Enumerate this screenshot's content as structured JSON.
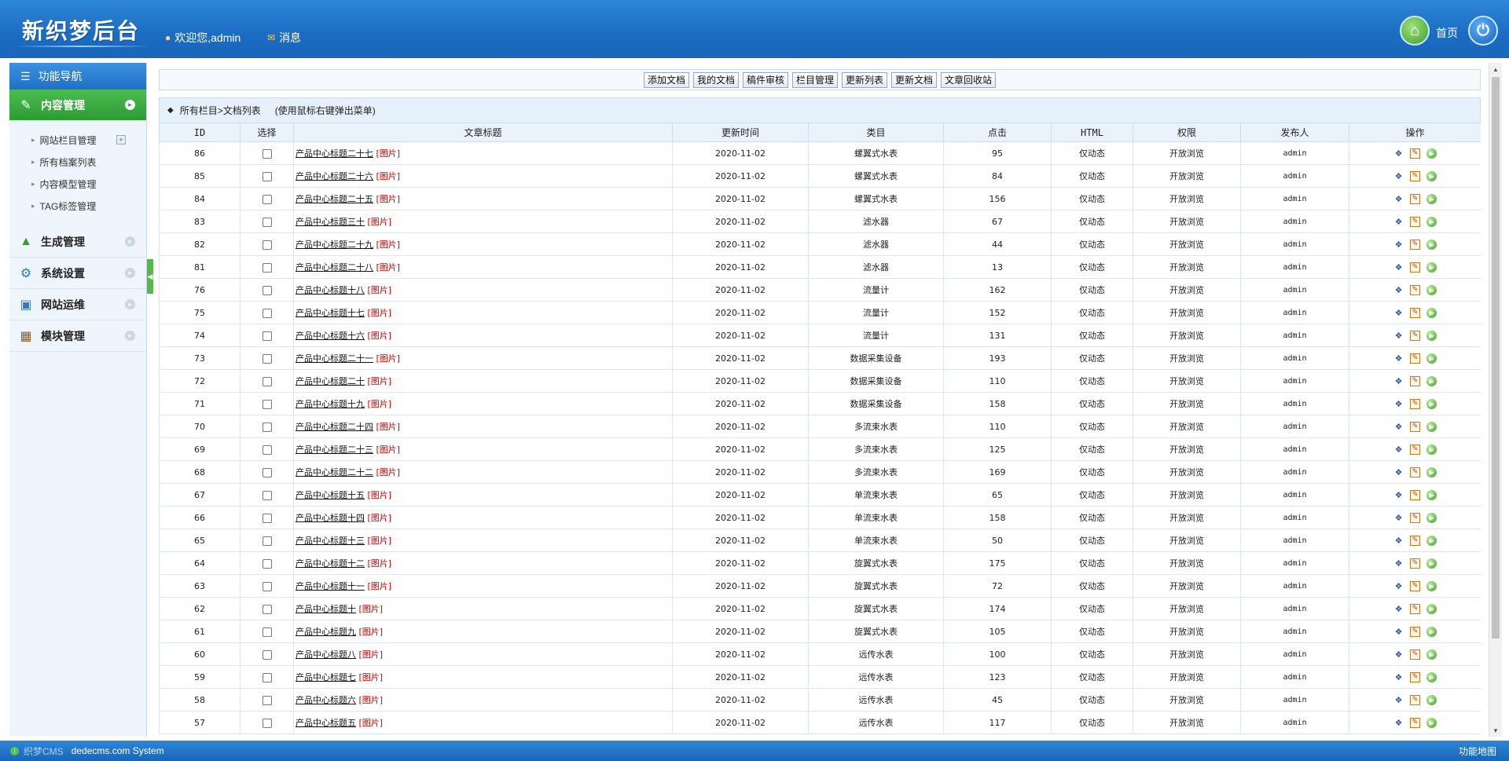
{
  "header": {
    "logo": "新织梦后台",
    "welcome": "欢迎您,admin",
    "messages": "消息",
    "home": "首页"
  },
  "sidebar": {
    "title": "功能导航",
    "sections": [
      {
        "label": "内容管理",
        "active": true
      },
      {
        "label": "生成管理"
      },
      {
        "label": "系统设置"
      },
      {
        "label": "网站运维"
      },
      {
        "label": "模块管理"
      }
    ],
    "content_items": [
      "网站栏目管理",
      "所有档案列表",
      "内容模型管理",
      "TAG标签管理"
    ]
  },
  "toolbar": {
    "buttons": [
      "添加文档",
      "我的文档",
      "稿件审核",
      "栏目管理",
      "更新列表",
      "更新文档",
      "文章回收站"
    ]
  },
  "list": {
    "heading": "所有栏目>文档列表",
    "hint": "(使用鼠标右键弹出菜单)",
    "columns": [
      "ID",
      "选择",
      "文章标题",
      "更新时间",
      "类目",
      "点击",
      "HTML",
      "权限",
      "发布人",
      "操作"
    ],
    "pic_tag": "[图片]",
    "rows": [
      {
        "id": "86",
        "title": "产品中心标题二十七",
        "date": "2020-11-02",
        "category": "螺翼式水表",
        "clicks": "95",
        "html": "仅动态",
        "perm": "开放浏览",
        "author": "admin"
      },
      {
        "id": "85",
        "title": "产品中心标题二十六",
        "date": "2020-11-02",
        "category": "螺翼式水表",
        "clicks": "84",
        "html": "仅动态",
        "perm": "开放浏览",
        "author": "admin"
      },
      {
        "id": "84",
        "title": "产品中心标题二十五",
        "date": "2020-11-02",
        "category": "螺翼式水表",
        "clicks": "156",
        "html": "仅动态",
        "perm": "开放浏览",
        "author": "admin"
      },
      {
        "id": "83",
        "title": "产品中心标题三十",
        "date": "2020-11-02",
        "category": "滤水器",
        "clicks": "67",
        "html": "仅动态",
        "perm": "开放浏览",
        "author": "admin"
      },
      {
        "id": "82",
        "title": "产品中心标题二十九",
        "date": "2020-11-02",
        "category": "滤水器",
        "clicks": "44",
        "html": "仅动态",
        "perm": "开放浏览",
        "author": "admin"
      },
      {
        "id": "81",
        "title": "产品中心标题二十八",
        "date": "2020-11-02",
        "category": "滤水器",
        "clicks": "13",
        "html": "仅动态",
        "perm": "开放浏览",
        "author": "admin"
      },
      {
        "id": "76",
        "title": "产品中心标题十八",
        "date": "2020-11-02",
        "category": "流量计",
        "clicks": "162",
        "html": "仅动态",
        "perm": "开放浏览",
        "author": "admin"
      },
      {
        "id": "75",
        "title": "产品中心标题十七",
        "date": "2020-11-02",
        "category": "流量计",
        "clicks": "152",
        "html": "仅动态",
        "perm": "开放浏览",
        "author": "admin"
      },
      {
        "id": "74",
        "title": "产品中心标题十六",
        "date": "2020-11-02",
        "category": "流量计",
        "clicks": "131",
        "html": "仅动态",
        "perm": "开放浏览",
        "author": "admin"
      },
      {
        "id": "73",
        "title": "产品中心标题二十一",
        "date": "2020-11-02",
        "category": "数据采集设备",
        "clicks": "193",
        "html": "仅动态",
        "perm": "开放浏览",
        "author": "admin"
      },
      {
        "id": "72",
        "title": "产品中心标题二十",
        "date": "2020-11-02",
        "category": "数据采集设备",
        "clicks": "110",
        "html": "仅动态",
        "perm": "开放浏览",
        "author": "admin"
      },
      {
        "id": "71",
        "title": "产品中心标题十九",
        "date": "2020-11-02",
        "category": "数据采集设备",
        "clicks": "158",
        "html": "仅动态",
        "perm": "开放浏览",
        "author": "admin"
      },
      {
        "id": "70",
        "title": "产品中心标题二十四",
        "date": "2020-11-02",
        "category": "多流束水表",
        "clicks": "110",
        "html": "仅动态",
        "perm": "开放浏览",
        "author": "admin"
      },
      {
        "id": "69",
        "title": "产品中心标题二十三",
        "date": "2020-11-02",
        "category": "多流束水表",
        "clicks": "125",
        "html": "仅动态",
        "perm": "开放浏览",
        "author": "admin"
      },
      {
        "id": "68",
        "title": "产品中心标题二十二",
        "date": "2020-11-02",
        "category": "多流束水表",
        "clicks": "169",
        "html": "仅动态",
        "perm": "开放浏览",
        "author": "admin"
      },
      {
        "id": "67",
        "title": "产品中心标题十五",
        "date": "2020-11-02",
        "category": "单流束水表",
        "clicks": "65",
        "html": "仅动态",
        "perm": "开放浏览",
        "author": "admin"
      },
      {
        "id": "66",
        "title": "产品中心标题十四",
        "date": "2020-11-02",
        "category": "单流束水表",
        "clicks": "158",
        "html": "仅动态",
        "perm": "开放浏览",
        "author": "admin"
      },
      {
        "id": "65",
        "title": "产品中心标题十三",
        "date": "2020-11-02",
        "category": "单流束水表",
        "clicks": "50",
        "html": "仅动态",
        "perm": "开放浏览",
        "author": "admin"
      },
      {
        "id": "64",
        "title": "产品中心标题十二",
        "date": "2020-11-02",
        "category": "旋翼式水表",
        "clicks": "175",
        "html": "仅动态",
        "perm": "开放浏览",
        "author": "admin"
      },
      {
        "id": "63",
        "title": "产品中心标题十一",
        "date": "2020-11-02",
        "category": "旋翼式水表",
        "clicks": "72",
        "html": "仅动态",
        "perm": "开放浏览",
        "author": "admin"
      },
      {
        "id": "62",
        "title": "产品中心标题十",
        "date": "2020-11-02",
        "category": "旋翼式水表",
        "clicks": "174",
        "html": "仅动态",
        "perm": "开放浏览",
        "author": "admin"
      },
      {
        "id": "61",
        "title": "产品中心标题九",
        "date": "2020-11-02",
        "category": "旋翼式水表",
        "clicks": "105",
        "html": "仅动态",
        "perm": "开放浏览",
        "author": "admin"
      },
      {
        "id": "60",
        "title": "产品中心标题八",
        "date": "2020-11-02",
        "category": "远传水表",
        "clicks": "100",
        "html": "仅动态",
        "perm": "开放浏览",
        "author": "admin"
      },
      {
        "id": "59",
        "title": "产品中心标题七",
        "date": "2020-11-02",
        "category": "远传水表",
        "clicks": "123",
        "html": "仅动态",
        "perm": "开放浏览",
        "author": "admin"
      },
      {
        "id": "58",
        "title": "产品中心标题六",
        "date": "2020-11-02",
        "category": "远传水表",
        "clicks": "45",
        "html": "仅动态",
        "perm": "开放浏览",
        "author": "admin"
      },
      {
        "id": "57",
        "title": "产品中心标题五",
        "date": "2020-11-02",
        "category": "远传水表",
        "clicks": "117",
        "html": "仅动态",
        "perm": "开放浏览",
        "author": "admin"
      }
    ],
    "ops_icons": [
      "properties-icon",
      "edit-icon",
      "preview-icon"
    ]
  },
  "footer": {
    "brand": "织梦CMS",
    "system": "dedecms.com System",
    "sitemap": "功能地图"
  },
  "colors": {
    "header_blue": "#1b6cc3",
    "active_green": "#2e9a34",
    "pic_red": "#cc0000"
  }
}
